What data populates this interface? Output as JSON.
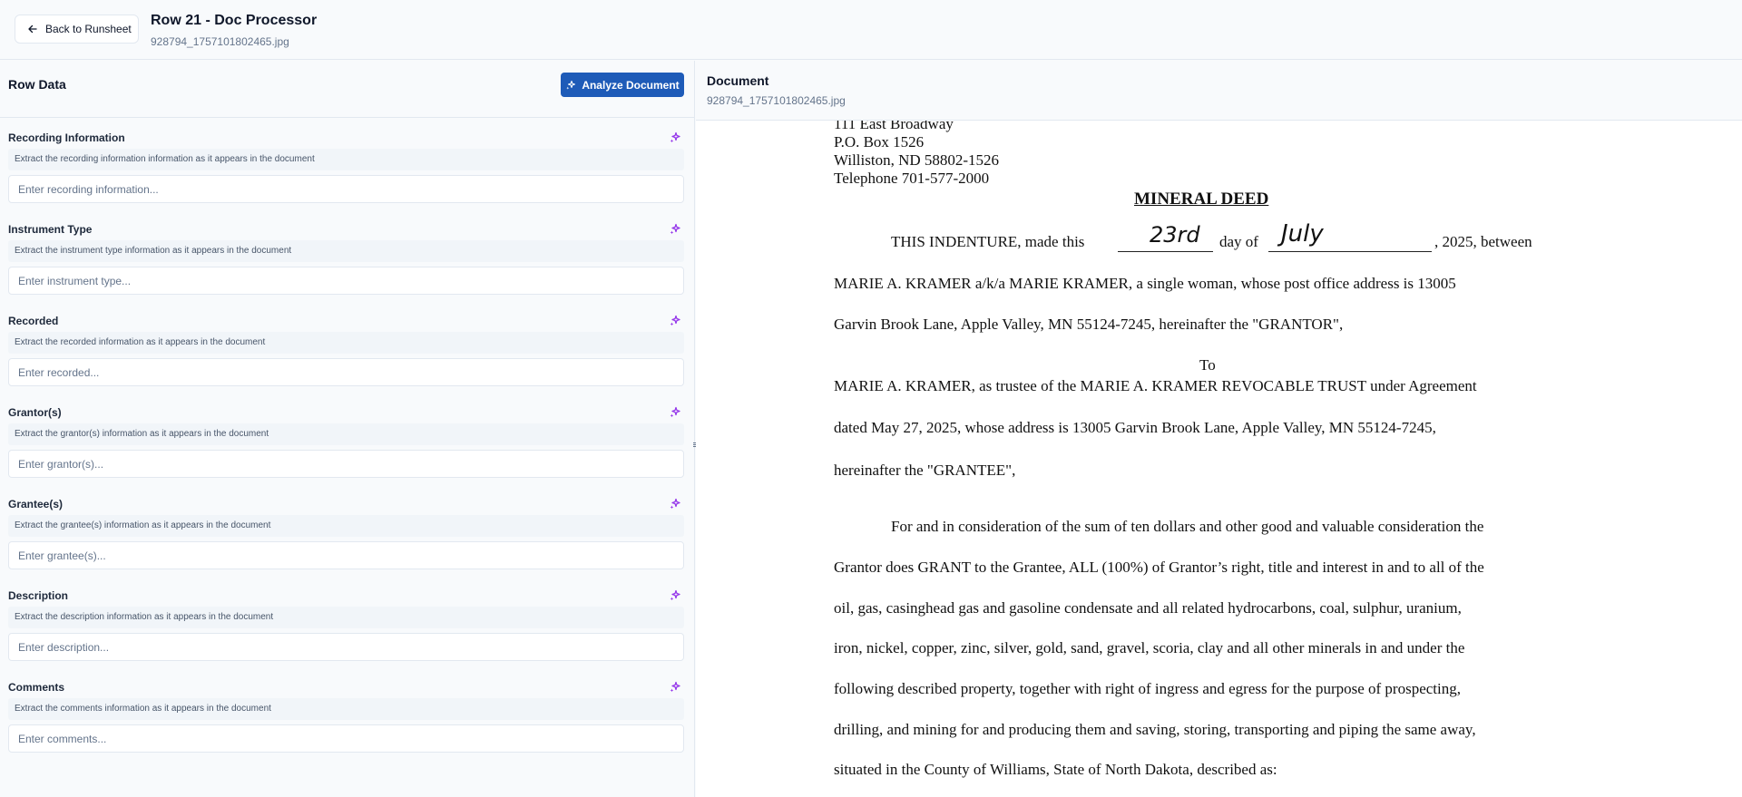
{
  "header": {
    "back_label": "Back to Runsheet",
    "title": "Row 21 - Doc Processor",
    "filename": "928794_1757101802465.jpg"
  },
  "left_panel": {
    "title": "Row Data",
    "analyze_label": "Analyze Document",
    "fields": [
      {
        "label": "Recording Information",
        "hint": "Extract the recording information information as it appears in the document",
        "placeholder": "Enter recording information..."
      },
      {
        "label": "Instrument Type",
        "hint": "Extract the instrument type information as it appears in the document",
        "placeholder": "Enter instrument type..."
      },
      {
        "label": "Recorded",
        "hint": "Extract the recorded information as it appears in the document",
        "placeholder": "Enter recorded..."
      },
      {
        "label": "Grantor(s)",
        "hint": "Extract the grantor(s) information as it appears in the document",
        "placeholder": "Enter grantor(s)..."
      },
      {
        "label": "Grantee(s)",
        "hint": "Extract the grantee(s) information as it appears in the document",
        "placeholder": "Enter grantee(s)..."
      },
      {
        "label": "Description",
        "hint": "Extract the description information as it appears in the document",
        "placeholder": "Enter description..."
      },
      {
        "label": "Comments",
        "hint": "Extract the comments information as it appears in the document",
        "placeholder": "Enter comments..."
      }
    ]
  },
  "right_panel": {
    "title": "Document",
    "filename": "928794_1757101802465.jpg"
  },
  "document": {
    "address_lines": [
      "111 East Broadway",
      "P.O. Box 1526",
      "Williston, ND 58802-1526",
      "Telephone 701-577-2000"
    ],
    "heading": "MINERAL DEED",
    "indenture_start": "THIS INDENTURE, made this",
    "day_hw": "23rd",
    "day_of": "day of",
    "month_hw": "July",
    "year_between": ", 2025, between",
    "lines": [
      "MARIE A. KRAMER a/k/a MARIE KRAMER, a single woman, whose post office address is 13005",
      "Garvin Brook Lane, Apple Valley, MN 55124-7245, hereinafter the \"GRANTOR\",",
      "To",
      "MARIE A. KRAMER, as trustee of the MARIE A. KRAMER REVOCABLE TRUST under Agreement",
      "dated May 27, 2025, whose address is 13005 Garvin Brook Lane, Apple Valley, MN 55124-7245,",
      "hereinafter the \"GRANTEE\",",
      "For and in consideration of the sum of ten dollars and other good and valuable consideration the",
      "Grantor does GRANT to the Grantee, ALL (100%) of Grantor’s right, title and interest in and to all of the",
      "oil, gas, casinghead gas and gasoline condensate and all related hydrocarbons, coal, sulphur, uranium,",
      "iron, nickel, copper, zinc, silver, gold, sand, gravel, scoria, clay and all other minerals in and under the",
      "following described property, together with right of ingress and egress for the purpose of prospecting,",
      "drilling, and mining for and producing them and saving, storing, transporting and piping the same away,",
      "situated in the County of Williams, State of North Dakota, described as:"
    ]
  },
  "colors": {
    "accent": "#1e5bb8",
    "sparkle": "#9333ea",
    "border": "#e2e8f0",
    "muted_text": "#64748b"
  },
  "icons": {
    "back": "arrow-left-icon",
    "analyze": "sparkles-icon",
    "field_action": "sparkles-icon"
  }
}
